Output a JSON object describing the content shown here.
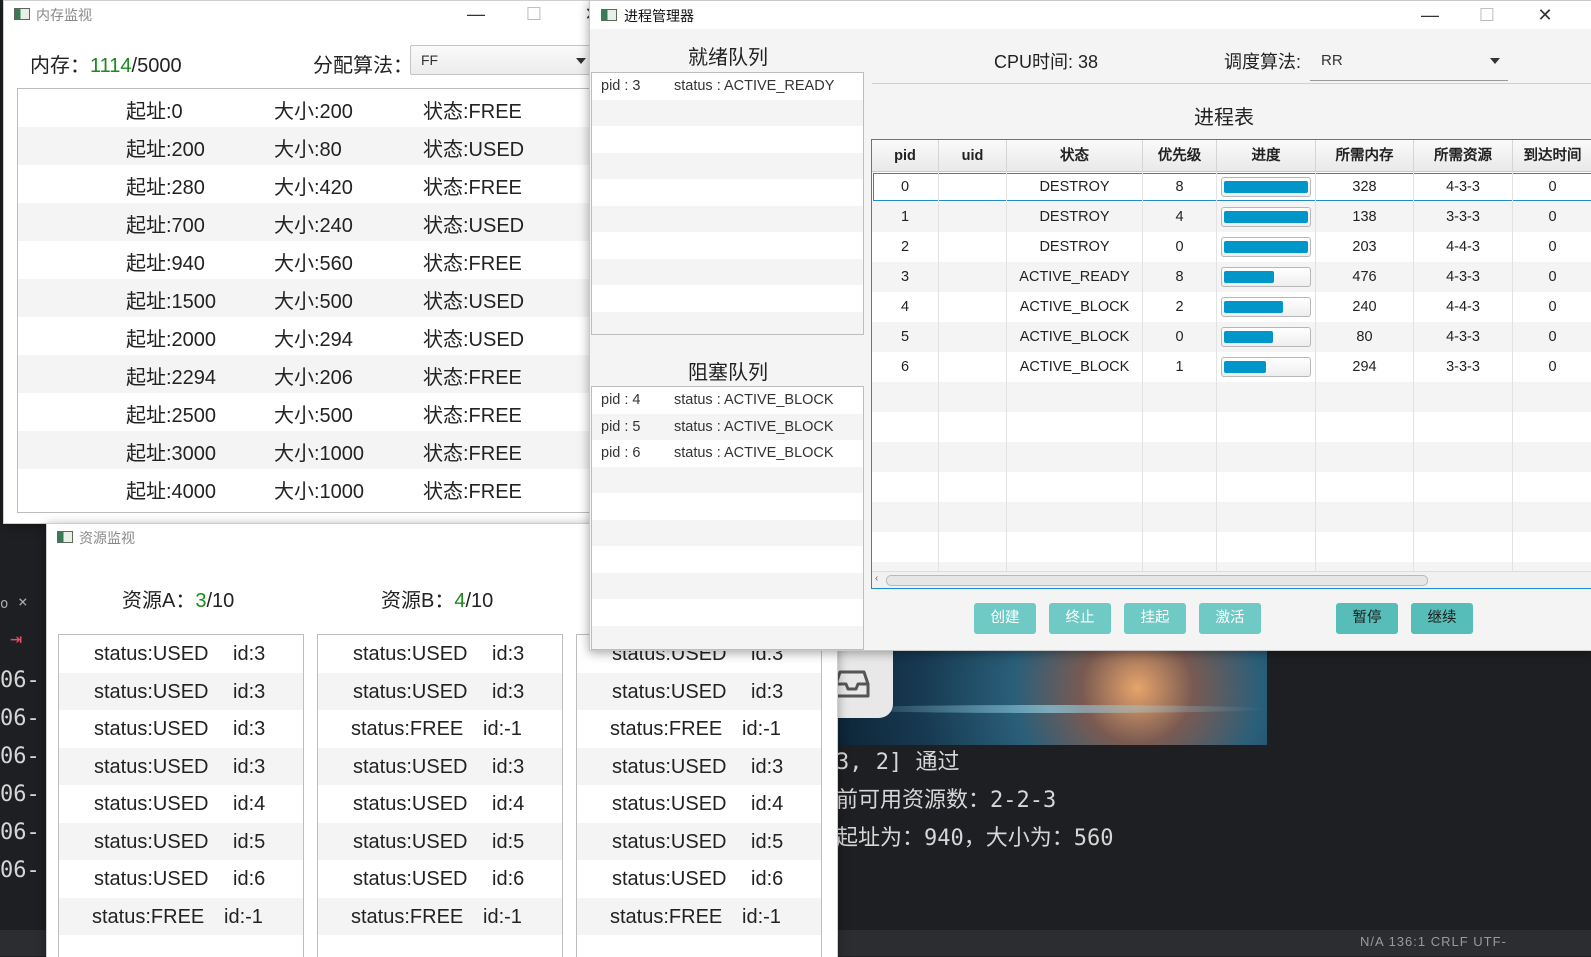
{
  "terminal": {
    "prefixes": [
      "06-",
      "06-",
      "06-",
      "06-",
      "06-",
      "06-",
      "06-"
    ],
    "lines": [
      "3, 2] 通过",
      "前可用资源数：2-2-3",
      "起址为：940，大小为：560"
    ],
    "side_x": "×",
    "status_bar": "N/A  136:1  CRLF  UTF-"
  },
  "memory_window": {
    "title": "内存监视",
    "mem_label": "内存：",
    "mem_used": "1114",
    "mem_total": "/5000",
    "alg_label": "分配算法：",
    "alg_value": "FF",
    "blocks": [
      {
        "start": "起址:0",
        "size": "大小:200",
        "status": "状态:FREE"
      },
      {
        "start": "起址:200",
        "size": "大小:80",
        "status": "状态:USED"
      },
      {
        "start": "起址:280",
        "size": "大小:420",
        "status": "状态:FREE"
      },
      {
        "start": "起址:700",
        "size": "大小:240",
        "status": "状态:USED"
      },
      {
        "start": "起址:940",
        "size": "大小:560",
        "status": "状态:FREE"
      },
      {
        "start": "起址:1500",
        "size": "大小:500",
        "status": "状态:USED"
      },
      {
        "start": "起址:2000",
        "size": "大小:294",
        "status": "状态:USED"
      },
      {
        "start": "起址:2294",
        "size": "大小:206",
        "status": "状态:FREE"
      },
      {
        "start": "起址:2500",
        "size": "大小:500",
        "status": "状态:FREE"
      },
      {
        "start": "起址:3000",
        "size": "大小:1000",
        "status": "状态:FREE"
      },
      {
        "start": "起址:4000",
        "size": "大小:1000",
        "status": "状态:FREE"
      }
    ]
  },
  "resource_window": {
    "title": "资源监视",
    "resA_label": "资源A：",
    "resA_used": "3",
    "resA_total": "/10",
    "resB_label": "资源B：",
    "resB_used": "4",
    "resB_total": "/10",
    "lists": [
      [
        {
          "status": "status:USED",
          "id": "id:3"
        },
        {
          "status": "status:USED",
          "id": "id:3"
        },
        {
          "status": "status:USED",
          "id": "id:3"
        },
        {
          "status": "status:USED",
          "id": "id:3"
        },
        {
          "status": "status:USED",
          "id": "id:4"
        },
        {
          "status": "status:USED",
          "id": "id:5"
        },
        {
          "status": "status:USED",
          "id": "id:6"
        },
        {
          "status": "status:FREE",
          "id": "id:-1"
        }
      ],
      [
        {
          "status": "status:USED",
          "id": "id:3"
        },
        {
          "status": "status:USED",
          "id": "id:3"
        },
        {
          "status": "status:FREE",
          "id": "id:-1"
        },
        {
          "status": "status:USED",
          "id": "id:3"
        },
        {
          "status": "status:USED",
          "id": "id:4"
        },
        {
          "status": "status:USED",
          "id": "id:5"
        },
        {
          "status": "status:USED",
          "id": "id:6"
        },
        {
          "status": "status:FREE",
          "id": "id:-1"
        }
      ],
      [
        {
          "status": "status:USED",
          "id": "id:3"
        },
        {
          "status": "status:USED",
          "id": "id:3"
        },
        {
          "status": "status:FREE",
          "id": "id:-1"
        },
        {
          "status": "status:USED",
          "id": "id:3"
        },
        {
          "status": "status:USED",
          "id": "id:4"
        },
        {
          "status": "status:USED",
          "id": "id:5"
        },
        {
          "status": "status:USED",
          "id": "id:6"
        },
        {
          "status": "status:FREE",
          "id": "id:-1"
        }
      ]
    ]
  },
  "process_window": {
    "title": "进程管理器",
    "ready_title": "就绪队列",
    "ready": [
      {
        "pid": "pid : 3",
        "status": "status : ACTIVE_READY"
      }
    ],
    "blocked_title": "阻塞队列",
    "blocked": [
      {
        "pid": "pid : 4",
        "status": "status : ACTIVE_BLOCK"
      },
      {
        "pid": "pid : 5",
        "status": "status : ACTIVE_BLOCK"
      },
      {
        "pid": "pid : 6",
        "status": "status : ACTIVE_BLOCK"
      }
    ],
    "cpu_label": "CPU时间:",
    "cpu_value": "38",
    "sched_label": "调度算法:",
    "sched_value": "RR",
    "table_title": "进程表",
    "columns": [
      "pid",
      "uid",
      "状态",
      "优先级",
      "进度",
      "所需内存",
      "所需资源",
      "到达时间"
    ],
    "rows": [
      {
        "pid": "0",
        "uid": "",
        "state": "DESTROY",
        "priority": "8",
        "progress": 1.0,
        "memory": "328",
        "resources": "4-3-3",
        "arrival": "0"
      },
      {
        "pid": "1",
        "uid": "",
        "state": "DESTROY",
        "priority": "4",
        "progress": 1.0,
        "memory": "138",
        "resources": "3-3-3",
        "arrival": "0"
      },
      {
        "pid": "2",
        "uid": "",
        "state": "DESTROY",
        "priority": "0",
        "progress": 1.0,
        "memory": "203",
        "resources": "4-4-3",
        "arrival": "0"
      },
      {
        "pid": "3",
        "uid": "",
        "state": "ACTIVE_READY",
        "priority": "8",
        "progress": 0.6,
        "memory": "476",
        "resources": "4-3-3",
        "arrival": "0"
      },
      {
        "pid": "4",
        "uid": "",
        "state": "ACTIVE_BLOCK",
        "priority": "2",
        "progress": 0.7,
        "memory": "240",
        "resources": "4-4-3",
        "arrival": "0"
      },
      {
        "pid": "5",
        "uid": "",
        "state": "ACTIVE_BLOCK",
        "priority": "0",
        "progress": 0.58,
        "memory": "80",
        "resources": "4-3-3",
        "arrival": "0"
      },
      {
        "pid": "6",
        "uid": "",
        "state": "ACTIVE_BLOCK",
        "priority": "1",
        "progress": 0.5,
        "memory": "294",
        "resources": "3-3-3",
        "arrival": "0"
      }
    ],
    "buttons": {
      "create": "创建",
      "terminate": "终止",
      "suspend": "挂起",
      "activate": "激活",
      "pause": "暂停",
      "resume": "继续"
    },
    "accent": "#0096c9",
    "button_color": "#6fcac6"
  }
}
